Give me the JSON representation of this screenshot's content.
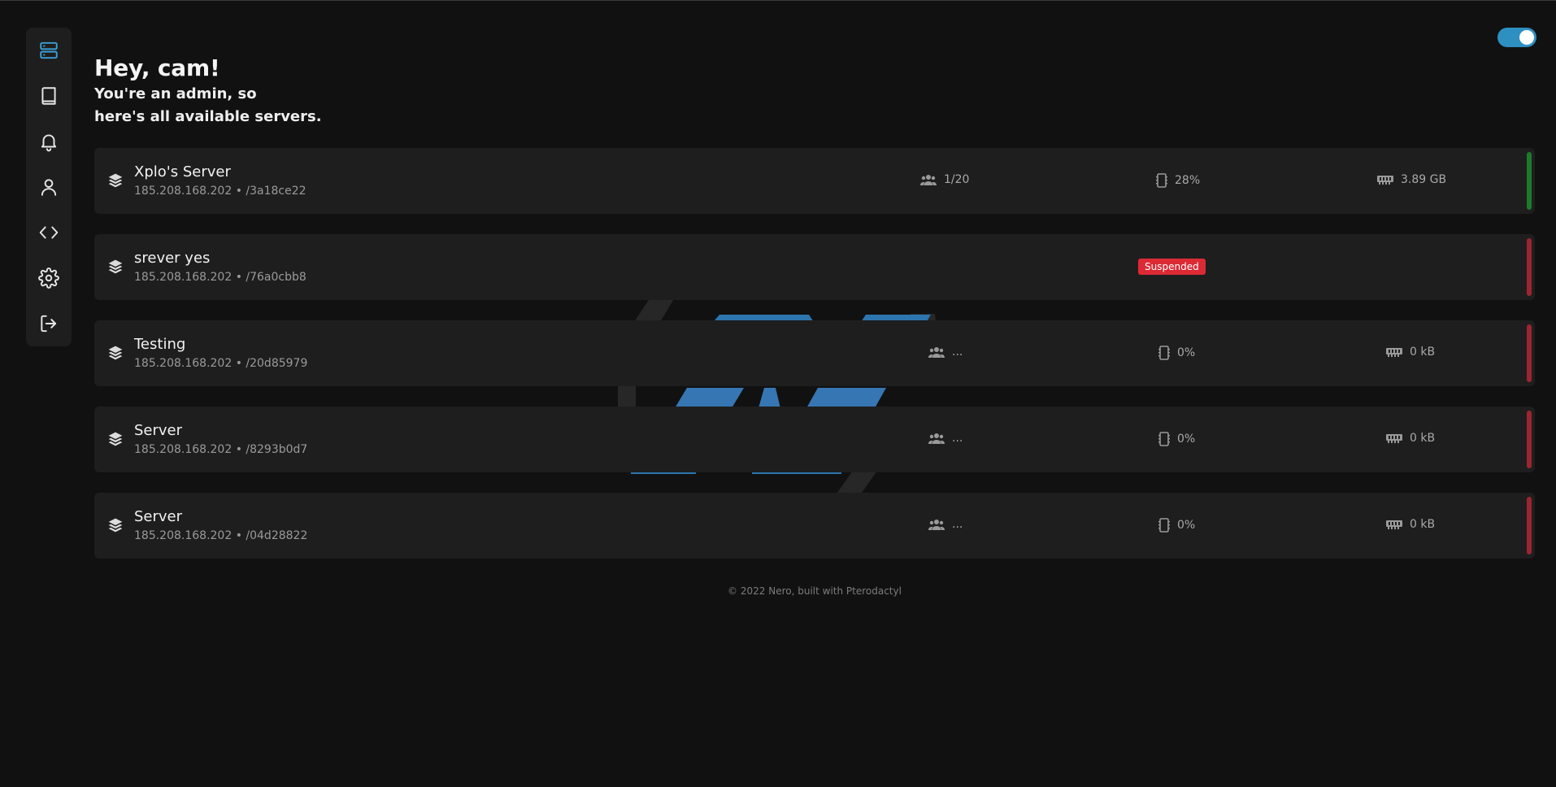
{
  "sidebar": {
    "items": [
      {
        "name": "servers",
        "icon": "server-icon"
      },
      {
        "name": "docs",
        "icon": "book-icon"
      },
      {
        "name": "notifications",
        "icon": "bell-icon"
      },
      {
        "name": "account",
        "icon": "user-icon"
      },
      {
        "name": "api",
        "icon": "code-icon"
      },
      {
        "name": "settings",
        "icon": "gear-icon"
      },
      {
        "name": "logout",
        "icon": "logout-icon"
      }
    ],
    "active": "servers"
  },
  "theme_toggle": {
    "on": true,
    "color": "#2e8fc1"
  },
  "greeting": {
    "title": "Hey, cam!",
    "line1": "You're an admin, so",
    "line2": "here's all available servers."
  },
  "servers": [
    {
      "name": "Xplo's Server",
      "address": "185.208.168.202 • /3a18ce22",
      "players": "1/20",
      "cpu": "28%",
      "memory": "3.89 GB",
      "status_color": "#1e7a2a",
      "suspended": false
    },
    {
      "name": "srever yes",
      "address": "185.208.168.202 • /76a0cbb8",
      "badge": "Suspended",
      "status_color": "#9c2530",
      "suspended": true
    },
    {
      "name": "Testing",
      "address": "185.208.168.202 • /20d85979",
      "players": "...",
      "cpu": "0%",
      "memory": "0 kB",
      "status_color": "#9c2530",
      "suspended": false
    },
    {
      "name": "Server",
      "address": "185.208.168.202 • /8293b0d7",
      "players": "...",
      "cpu": "0%",
      "memory": "0 kB",
      "status_color": "#9c2530",
      "suspended": false
    },
    {
      "name": "Server",
      "address": "185.208.168.202 • /04d28822",
      "players": "...",
      "cpu": "0%",
      "memory": "0 kB",
      "status_color": "#9c2530",
      "suspended": false
    }
  ],
  "footer": "© 2022 Nero, built with Pterodactyl"
}
